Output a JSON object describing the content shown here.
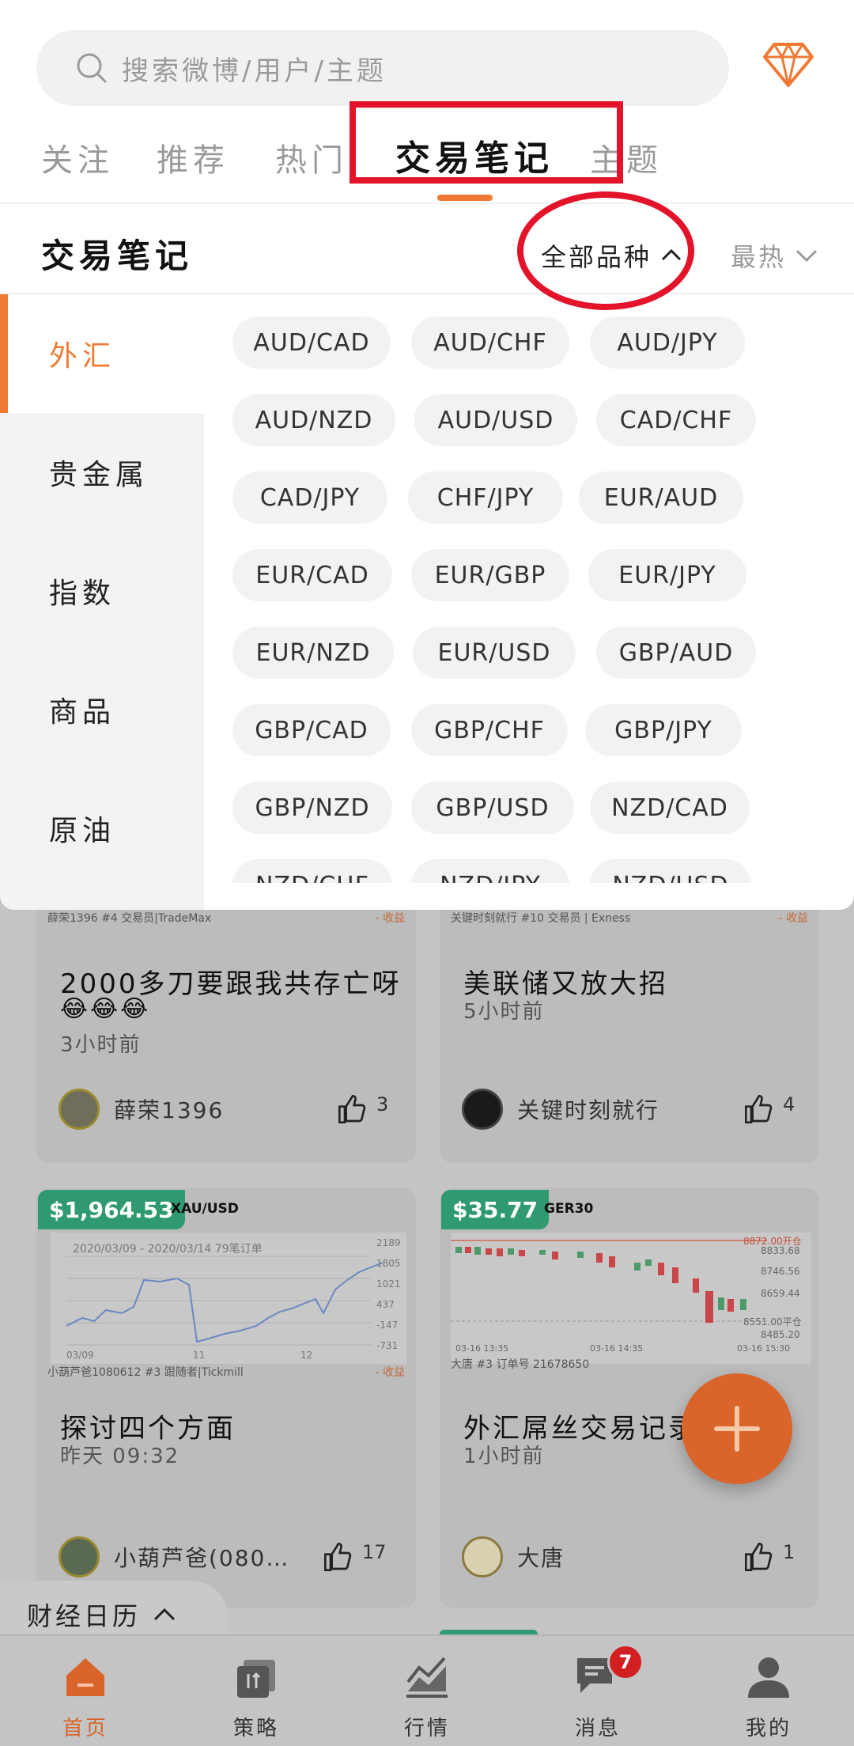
{
  "search": {
    "placeholder": "搜索微博/用户/主题"
  },
  "tabs": [
    "关注",
    "推荐",
    "热门",
    "交易笔记",
    "主题"
  ],
  "active_tab_index": 3,
  "section": {
    "title": "交易笔记",
    "filter_all": "全部品种",
    "filter_sort": "最热"
  },
  "categories": [
    "外汇",
    "贵金属",
    "指数",
    "商品",
    "原油"
  ],
  "active_category_index": 0,
  "pairs": [
    "AUD/CAD",
    "AUD/CHF",
    "AUD/JPY",
    "AUD/NZD",
    "AUD/USD",
    "CAD/CHF",
    "CAD/JPY",
    "CHF/JPY",
    "EUR/AUD",
    "EUR/CAD",
    "EUR/GBP",
    "EUR/JPY",
    "EUR/NZD",
    "EUR/USD",
    "GBP/AUD",
    "GBP/CAD",
    "GBP/CHF",
    "GBP/JPY",
    "GBP/NZD",
    "GBP/USD",
    "NZD/CAD",
    "NZD/CHF",
    "NZD/JPY",
    "NZD/USD"
  ],
  "feed": {
    "post1": {
      "meta": "薛荣1396 #4 交易员|TradeMax",
      "tag": "- 收益",
      "text": "2000多刀要跟我共存亡呀",
      "emoji": "😂😂😂",
      "time": "3小时前",
      "author": "薛荣1396",
      "likes": "3"
    },
    "post2": {
      "meta": "关键时刻就行 #10  交易员 | Exness",
      "tag": "- 收益",
      "text": "美联储又放大招",
      "time": "5小时前",
      "author": "关键时刻就行",
      "likes": "4"
    },
    "post3": {
      "price": "$1,964.53",
      "symbol": "XAU/USD",
      "chart_header": "2020/03/09 - 2020/03/14  79笔订单",
      "chart_dates": [
        "03/09",
        "11",
        "12"
      ],
      "chart_levels": [
        "2189",
        "1805",
        "1021",
        "437",
        "-147",
        "-731"
      ],
      "meta": "小葫芦爸1080612 #3 跟随者|Tickmill",
      "tag": "- 收益",
      "text": "探讨四个方面",
      "time": "昨天 09:32",
      "author": "小葫芦爸(080…",
      "likes": "17"
    },
    "post4": {
      "price": "$35.77",
      "symbol": "GER30",
      "chart_open": "8872.00开仓",
      "chart_close": "8551.00平仓",
      "chart_levels": [
        "8833.68",
        "8746.56",
        "8659.44",
        "8485.20"
      ],
      "chart_times": [
        "03-16 13:35",
        "03-16 14:35",
        "03-16 15:30"
      ],
      "meta": "大唐 #3    订单号 21678650",
      "text": "外汇屌丝交易记录",
      "time": "1小时前",
      "author": "大唐",
      "likes": "1"
    }
  },
  "calendar": {
    "label": "财经日历"
  },
  "bottom_nav": [
    {
      "label": "首页",
      "icon": "home-icon"
    },
    {
      "label": "策略",
      "icon": "strategy-icon"
    },
    {
      "label": "行情",
      "icon": "market-icon"
    },
    {
      "label": "消息",
      "icon": "message-icon",
      "badge": "7"
    },
    {
      "label": "我的",
      "icon": "profile-icon"
    }
  ],
  "colors": {
    "accent": "#f07a33",
    "annotation": "#e3142a",
    "price_badge": "#2f9a70",
    "notify_badge": "#d11f22"
  }
}
